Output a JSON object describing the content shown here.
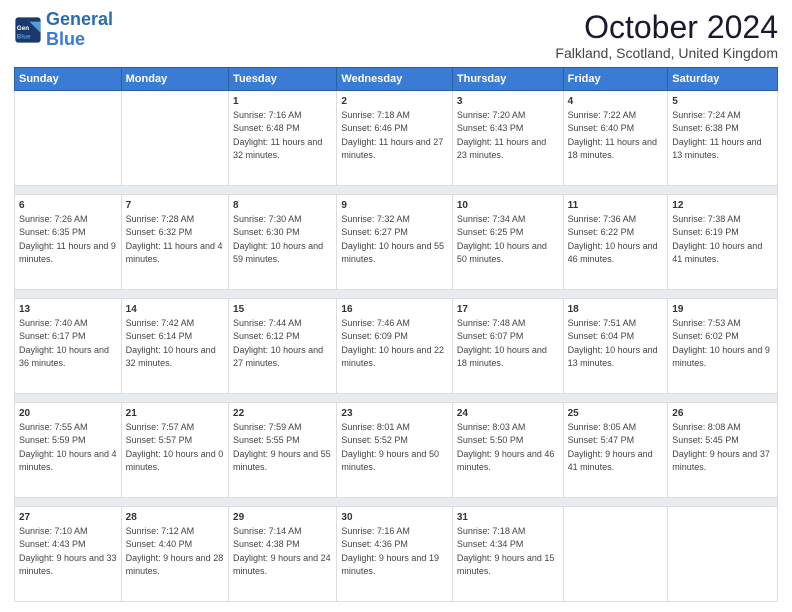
{
  "logo": {
    "line1": "General",
    "line2": "Blue"
  },
  "title": "October 2024",
  "subtitle": "Falkland, Scotland, United Kingdom",
  "header_days": [
    "Sunday",
    "Monday",
    "Tuesday",
    "Wednesday",
    "Thursday",
    "Friday",
    "Saturday"
  ],
  "weeks": [
    [
      {
        "day": "",
        "info": ""
      },
      {
        "day": "",
        "info": ""
      },
      {
        "day": "1",
        "info": "Sunrise: 7:16 AM\nSunset: 6:48 PM\nDaylight: 11 hours and 32 minutes."
      },
      {
        "day": "2",
        "info": "Sunrise: 7:18 AM\nSunset: 6:46 PM\nDaylight: 11 hours and 27 minutes."
      },
      {
        "day": "3",
        "info": "Sunrise: 7:20 AM\nSunset: 6:43 PM\nDaylight: 11 hours and 23 minutes."
      },
      {
        "day": "4",
        "info": "Sunrise: 7:22 AM\nSunset: 6:40 PM\nDaylight: 11 hours and 18 minutes."
      },
      {
        "day": "5",
        "info": "Sunrise: 7:24 AM\nSunset: 6:38 PM\nDaylight: 11 hours and 13 minutes."
      }
    ],
    [
      {
        "day": "6",
        "info": "Sunrise: 7:26 AM\nSunset: 6:35 PM\nDaylight: 11 hours and 9 minutes."
      },
      {
        "day": "7",
        "info": "Sunrise: 7:28 AM\nSunset: 6:32 PM\nDaylight: 11 hours and 4 minutes."
      },
      {
        "day": "8",
        "info": "Sunrise: 7:30 AM\nSunset: 6:30 PM\nDaylight: 10 hours and 59 minutes."
      },
      {
        "day": "9",
        "info": "Sunrise: 7:32 AM\nSunset: 6:27 PM\nDaylight: 10 hours and 55 minutes."
      },
      {
        "day": "10",
        "info": "Sunrise: 7:34 AM\nSunset: 6:25 PM\nDaylight: 10 hours and 50 minutes."
      },
      {
        "day": "11",
        "info": "Sunrise: 7:36 AM\nSunset: 6:22 PM\nDaylight: 10 hours and 46 minutes."
      },
      {
        "day": "12",
        "info": "Sunrise: 7:38 AM\nSunset: 6:19 PM\nDaylight: 10 hours and 41 minutes."
      }
    ],
    [
      {
        "day": "13",
        "info": "Sunrise: 7:40 AM\nSunset: 6:17 PM\nDaylight: 10 hours and 36 minutes."
      },
      {
        "day": "14",
        "info": "Sunrise: 7:42 AM\nSunset: 6:14 PM\nDaylight: 10 hours and 32 minutes."
      },
      {
        "day": "15",
        "info": "Sunrise: 7:44 AM\nSunset: 6:12 PM\nDaylight: 10 hours and 27 minutes."
      },
      {
        "day": "16",
        "info": "Sunrise: 7:46 AM\nSunset: 6:09 PM\nDaylight: 10 hours and 22 minutes."
      },
      {
        "day": "17",
        "info": "Sunrise: 7:48 AM\nSunset: 6:07 PM\nDaylight: 10 hours and 18 minutes."
      },
      {
        "day": "18",
        "info": "Sunrise: 7:51 AM\nSunset: 6:04 PM\nDaylight: 10 hours and 13 minutes."
      },
      {
        "day": "19",
        "info": "Sunrise: 7:53 AM\nSunset: 6:02 PM\nDaylight: 10 hours and 9 minutes."
      }
    ],
    [
      {
        "day": "20",
        "info": "Sunrise: 7:55 AM\nSunset: 5:59 PM\nDaylight: 10 hours and 4 minutes."
      },
      {
        "day": "21",
        "info": "Sunrise: 7:57 AM\nSunset: 5:57 PM\nDaylight: 10 hours and 0 minutes."
      },
      {
        "day": "22",
        "info": "Sunrise: 7:59 AM\nSunset: 5:55 PM\nDaylight: 9 hours and 55 minutes."
      },
      {
        "day": "23",
        "info": "Sunrise: 8:01 AM\nSunset: 5:52 PM\nDaylight: 9 hours and 50 minutes."
      },
      {
        "day": "24",
        "info": "Sunrise: 8:03 AM\nSunset: 5:50 PM\nDaylight: 9 hours and 46 minutes."
      },
      {
        "day": "25",
        "info": "Sunrise: 8:05 AM\nSunset: 5:47 PM\nDaylight: 9 hours and 41 minutes."
      },
      {
        "day": "26",
        "info": "Sunrise: 8:08 AM\nSunset: 5:45 PM\nDaylight: 9 hours and 37 minutes."
      }
    ],
    [
      {
        "day": "27",
        "info": "Sunrise: 7:10 AM\nSunset: 4:43 PM\nDaylight: 9 hours and 33 minutes."
      },
      {
        "day": "28",
        "info": "Sunrise: 7:12 AM\nSunset: 4:40 PM\nDaylight: 9 hours and 28 minutes."
      },
      {
        "day": "29",
        "info": "Sunrise: 7:14 AM\nSunset: 4:38 PM\nDaylight: 9 hours and 24 minutes."
      },
      {
        "day": "30",
        "info": "Sunrise: 7:16 AM\nSunset: 4:36 PM\nDaylight: 9 hours and 19 minutes."
      },
      {
        "day": "31",
        "info": "Sunrise: 7:18 AM\nSunset: 4:34 PM\nDaylight: 9 hours and 15 minutes."
      },
      {
        "day": "",
        "info": ""
      },
      {
        "day": "",
        "info": ""
      }
    ]
  ]
}
